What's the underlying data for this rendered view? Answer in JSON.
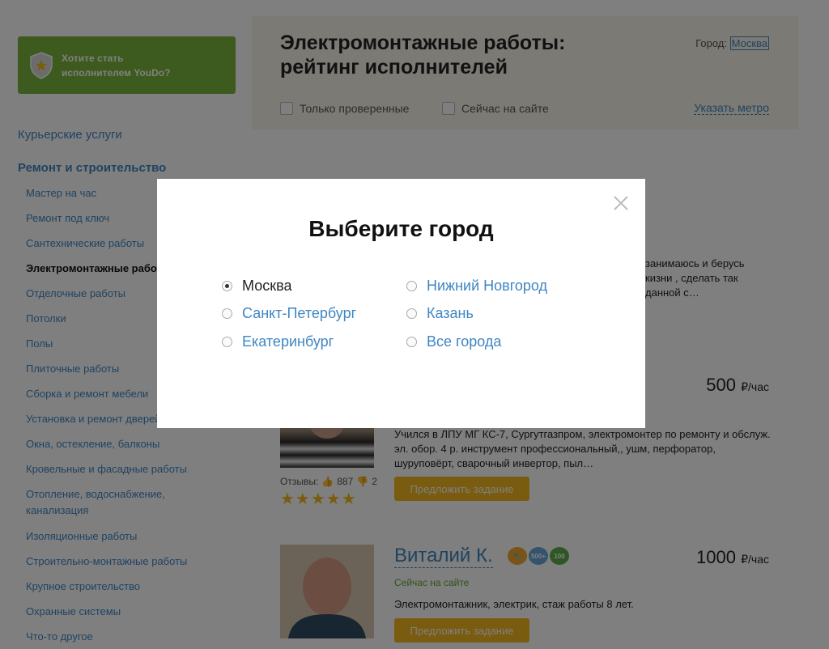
{
  "sidebar": {
    "promo": "Хотите стать исполнителем YouDo?",
    "top_categories": [
      {
        "label": "Курьерские услуги"
      },
      {
        "label": "Ремонт и строительство"
      }
    ],
    "sub_items": [
      "Мастер на час",
      "Ремонт под ключ",
      "Сантехнические работы",
      "Электромонтажные работы",
      "Отделочные работы",
      "Потолки",
      "Полы",
      "Плиточные работы",
      "Сборка и ремонт мебели",
      "Установка и ремонт дверей",
      "Окна, остекление, балконы",
      "Кровельные и фасадные работы",
      "Отопление, водоснабжение, канализация",
      "Изоляционные работы",
      "Строительно-монтажные работы",
      "Крупное строительство",
      "Охранные системы",
      "Что-то другое"
    ]
  },
  "main": {
    "title": "Электромонтажные работы: рейтинг исполнителей",
    "city_label": "Город:",
    "city_value": "Москва",
    "only_verified": "Только проверенные",
    "now_online": "Сейчас на сайте",
    "metro_link": "Указать метро"
  },
  "cards": {
    "partial_text": "занимаюсь и берусь\nкизни , сделать так\nданной с…",
    "c1": {
      "price": "500",
      "unit": "₽/час",
      "desc": "Учился в ЛПУ МГ КС-7, Сургутгазпром, электромонтер по ремонту и обслуж. эл. обор. 4 р. инструмент профессиональный,, ушм, перфоратор, шуруповёрт, сварочный инвертор, пыл…",
      "reviews_label": "Отзывы:",
      "likes": "887",
      "dislikes": "2",
      "stars": "★★★★★",
      "offer": "Предложить задание"
    },
    "c2": {
      "name": "Виталий К.",
      "price": "1000",
      "unit": "₽/час",
      "online": "Сейчас на сайте",
      "desc": "Электромонтажник, электрик, стаж работы 8 лет.",
      "badge_500": "500+",
      "badge_100": "100",
      "offer": "Предложить задание"
    }
  },
  "modal": {
    "title": "Выберите город",
    "cities": [
      "Москва",
      "Санкт-Петербург",
      "Екатеринбург",
      "Нижний Новгород",
      "Казань",
      "Все города"
    ],
    "selected": "Москва"
  },
  "colors": {
    "link": "#3f86c3",
    "promo": "#7bb73c",
    "button": "#f5b821",
    "panel": "#f6f5e9"
  }
}
